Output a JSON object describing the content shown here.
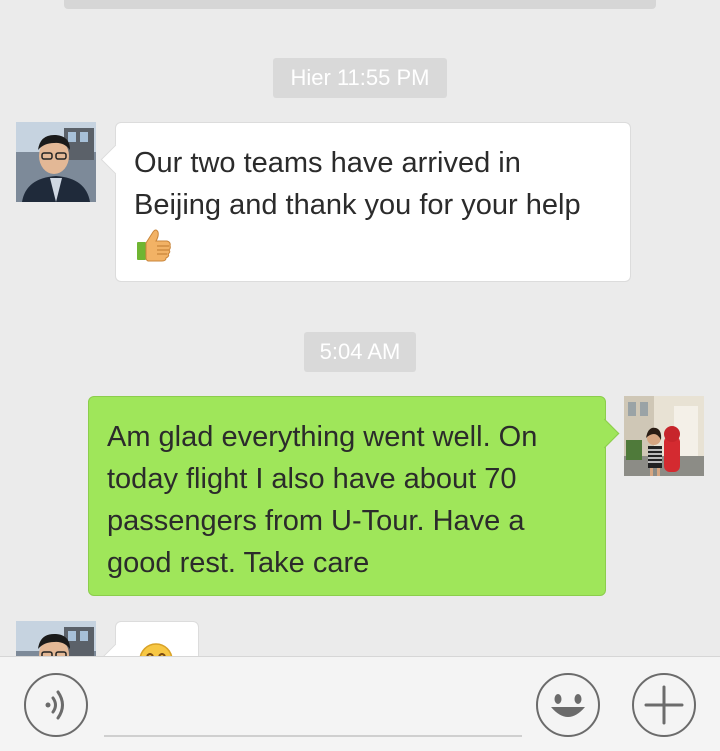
{
  "chat": {
    "timestamps": [
      "Hier 11:55 PM",
      "5:04 AM"
    ],
    "messages": [
      {
        "side": "left",
        "text": "Our two teams have arrived in Beijing and thank you for your help",
        "emoji": "thumbs-up-icon"
      },
      {
        "side": "right",
        "text": "Am glad everything went well. On today flight I also have about 70 passengers from U-Tour. Have a good rest. Take care"
      },
      {
        "side": "left",
        "emoji": "smiley-emoji-icon"
      }
    ]
  },
  "input_bar": {
    "voice_icon": "voice-icon",
    "emoji_icon": "emoji-face-icon",
    "plus_icon": "plus-icon",
    "input_value": ""
  },
  "colors": {
    "background": "#ebebeb",
    "incoming_bubble": "#ffffff",
    "outgoing_bubble": "#9fe65a",
    "timestamp_bg": "#d9d9d9"
  }
}
